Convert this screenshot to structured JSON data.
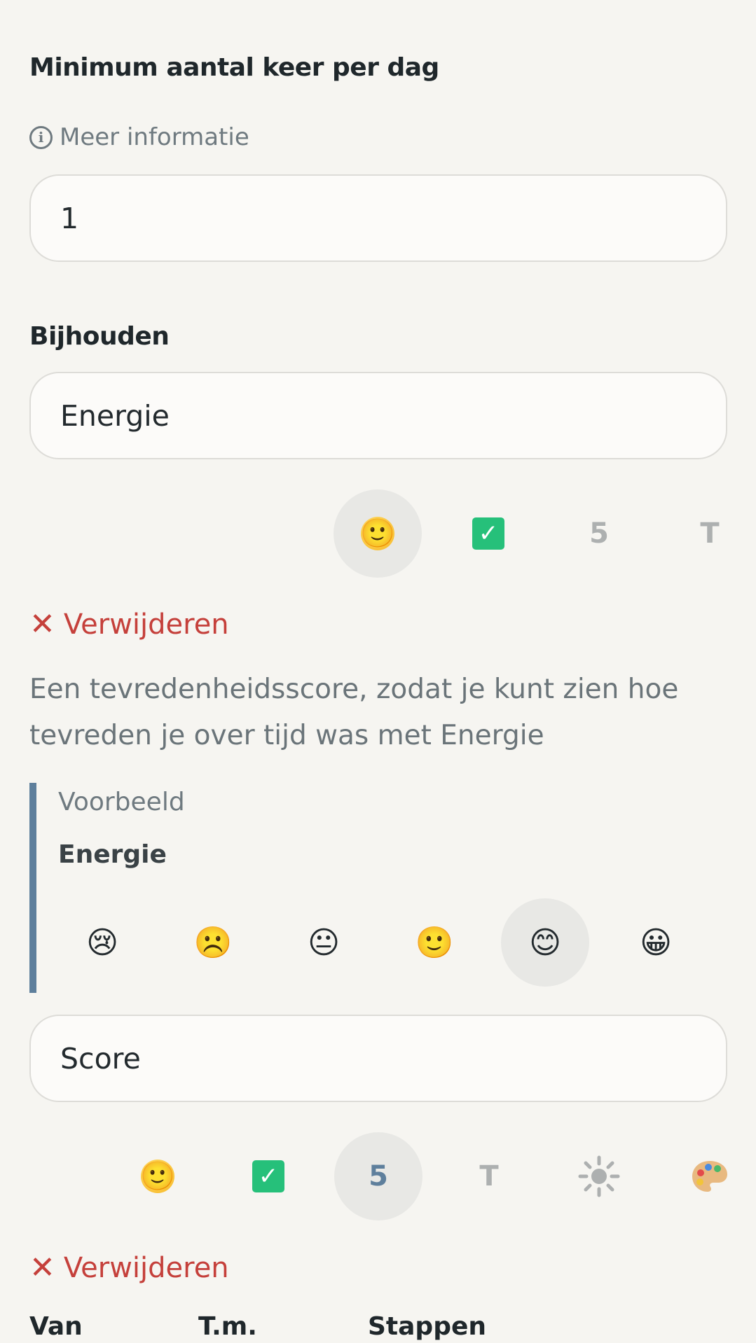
{
  "min_per_day": {
    "title": "Minimum aantal keer per dag",
    "info_label": "Meer informatie",
    "value": "1"
  },
  "tracking": {
    "title": "Bijhouden",
    "items": [
      {
        "name_value": "Energie",
        "type_options": [
          "😐 smiley",
          "✅ check",
          "5",
          "T"
        ],
        "selected_type": "smiley",
        "remove_label": "Verwijderen",
        "description": "Een tevredenheidsscore, zodat je kunt zien hoe tevreden je over tijd was met Energie",
        "example": {
          "caption": "Voorbeeld",
          "title": "Energie",
          "emojis": [
            "😢",
            "☹️",
            "😐",
            "🙂",
            "😊",
            "😀"
          ],
          "selected_index": 4
        }
      },
      {
        "name_value": "Score",
        "type_options": [
          "🙂",
          "✅",
          "5",
          "T",
          "☀",
          "🎨"
        ],
        "selected_type": "number",
        "remove_label": "Verwijderen"
      }
    ]
  },
  "toolbar_labels": {
    "number": "5",
    "text": "T"
  },
  "columns": {
    "from": "Van",
    "to": "T.m.",
    "steps": "Stappen"
  },
  "icons": {
    "info": "info-icon",
    "remove": "close-icon",
    "check": "check-icon",
    "sun": "sun-icon",
    "palette": "palette-icon"
  },
  "colors": {
    "background": "#f6f5f1",
    "accent_blue": "#5e7f9c",
    "danger_red": "#c5403b",
    "muted_text": "#6f7a80"
  }
}
